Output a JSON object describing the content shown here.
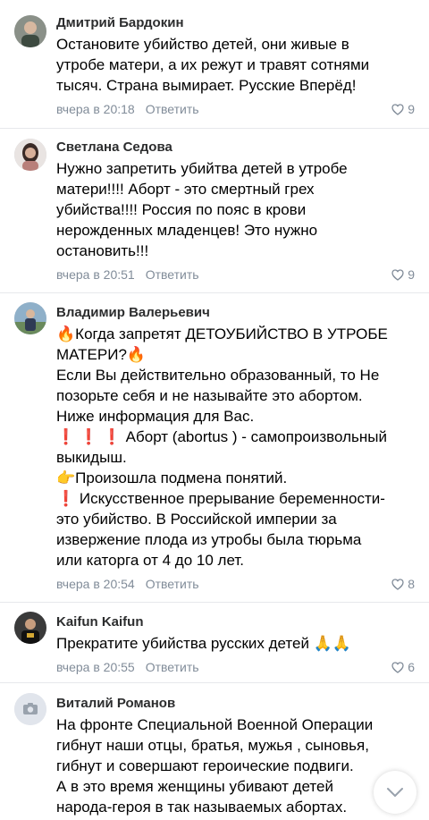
{
  "comments": [
    {
      "author": "Дмитрий Бардокин",
      "lines": [
        "Остановите убийство детей, они живые в",
        "утробе матери, а их режут и травят сотнями",
        "тысяч. Страна вымирает. Русские Вперёд!"
      ],
      "time": "вчера в 20:18",
      "reply": "Ответить",
      "likes": "9"
    },
    {
      "author": "Светлана Седова",
      "lines": [
        "Нужно запретить убийтва детей в утробе",
        "матери!!!! Аборт - это смертный грех",
        "убийства!!!! Россия по пояс в крови",
        "нерожденных младенцев! Это нужно",
        "остановить!!!"
      ],
      "time": "вчера в 20:51",
      "reply": "Ответить",
      "likes": "9"
    },
    {
      "author": "Владимир Валерьевич",
      "lines": [
        "🔥Когда запретят ДЕТОУБИЙСТВО В УТРОБЕ",
        "МАТЕРИ?🔥",
        "Если Вы действительно образованный, то Не",
        "позорьте себя и не называйте это абортом.",
        "Ниже информация для Вас.",
        "❗ ❗ ❗ Аборт  (abortus ) - самопроизвольный",
        "выкидыш.",
        "👉Произошла подмена понятий.",
        "❗  Искусственное прерывание беременности-",
        "это убийство.  В Российской империи за",
        "извержение плода  из утробы была тюрьма",
        "или каторга от 4 до 10 лет."
      ],
      "time": "вчера в 20:54",
      "reply": "Ответить",
      "likes": "8"
    },
    {
      "author": "Kaifun Kaifun",
      "lines": [
        "Прекратите убийства русских детей 🙏🙏"
      ],
      "time": "вчера в 20:55",
      "reply": "Ответить",
      "likes": "6"
    },
    {
      "author": "Виталий Романов",
      "lines": [
        "На фронте Специальной Военной Операции",
        "гибнут наши отцы, братья, мужья , сыновья,",
        "гибнут и совершают героические подвиги.",
        "А в это время женщины убивают детей",
        "народа-героя в так называемых абортах."
      ],
      "time": "",
      "reply": "",
      "likes": ""
    }
  ]
}
